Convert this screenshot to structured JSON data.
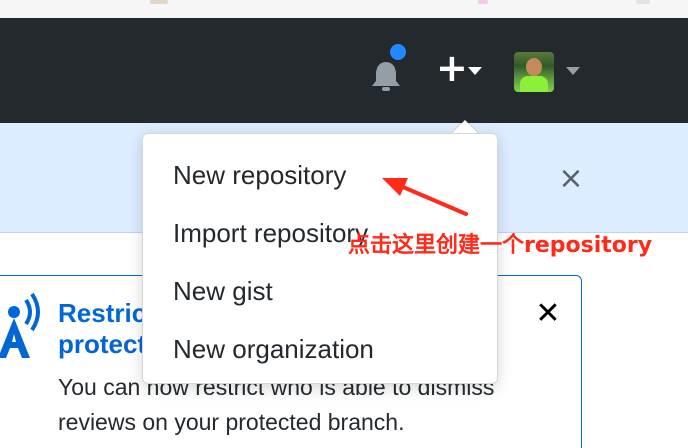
{
  "header": {
    "notification_icon": "bell-icon",
    "new_menu_symbol": "+",
    "new_menu_icon": "plus-icon",
    "avatar_icon": "avatar"
  },
  "flash": {
    "close_symbol": "×"
  },
  "dropdown": {
    "items": [
      {
        "label": "New repository"
      },
      {
        "label": "Import repository"
      },
      {
        "label": "New gist"
      },
      {
        "label": "New organization"
      }
    ]
  },
  "announcement": {
    "title": "Restrict\nprotected",
    "body": "You can now restrict who is able to dismiss reviews on your protected branch.",
    "close_symbol": "✕"
  },
  "annotation": {
    "text": "点击这里创建一个repository",
    "color": "#ff2a1a"
  },
  "colors": {
    "header_bg": "#24292e",
    "flash_bg": "#dbedff",
    "link_blue": "#0366d6",
    "notification_dot": "#2188ff"
  }
}
